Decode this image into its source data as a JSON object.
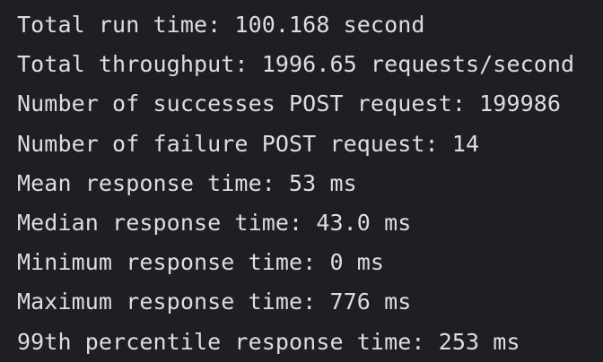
{
  "console": {
    "lines": [
      "Total run time: 100.168 second",
      "Total throughput: 1996.65 requests/second",
      "Number of successes POST request: 199986",
      "Number of failure POST request: 14",
      "Mean response time: 53 ms",
      "Median response time: 43.0 ms",
      "Minimum response time: 0 ms",
      "Maximum response time: 776 ms",
      "99th percentile response time: 253 ms"
    ],
    "colors": {
      "background": "#1e1f22",
      "text": "#dcdee3"
    }
  }
}
